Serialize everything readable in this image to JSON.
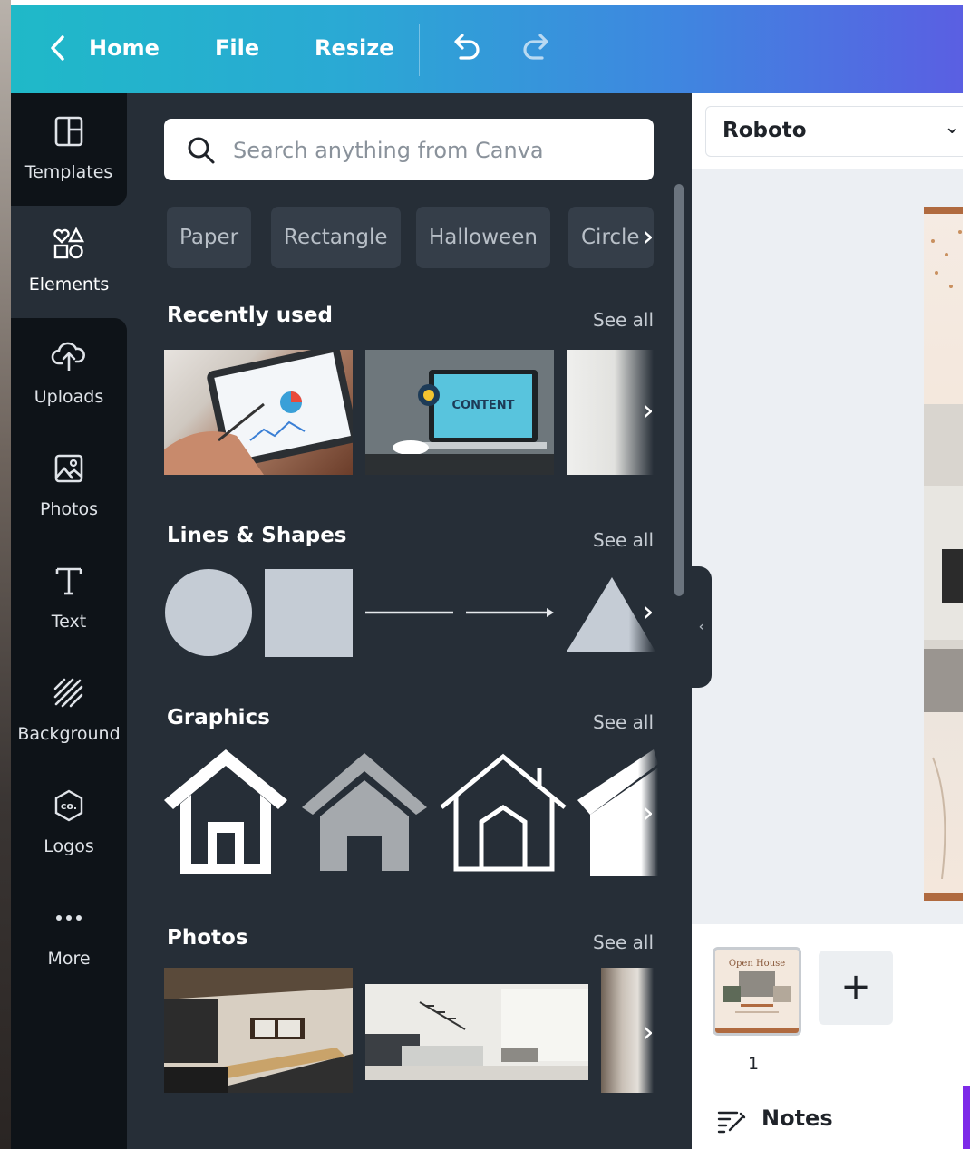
{
  "topbar": {
    "home_label": "Home",
    "file_label": "File",
    "resize_label": "Resize"
  },
  "sidebar": {
    "items": [
      {
        "label": "Templates",
        "icon": "templates-icon"
      },
      {
        "label": "Elements",
        "icon": "elements-icon"
      },
      {
        "label": "Uploads",
        "icon": "upload-cloud-icon"
      },
      {
        "label": "Photos",
        "icon": "photo-icon"
      },
      {
        "label": "Text",
        "icon": "text-icon"
      },
      {
        "label": "Background",
        "icon": "background-hatch-icon"
      },
      {
        "label": "Logos",
        "icon": "logo-co-icon"
      },
      {
        "label": "More",
        "icon": "more-dots-icon"
      }
    ]
  },
  "panel": {
    "search": {
      "placeholder": "Search anything from Canva"
    },
    "chips": [
      "Paper",
      "Rectangle",
      "Halloween",
      "Circle"
    ],
    "sections": {
      "recent": {
        "title": "Recently used",
        "see_all": "See all"
      },
      "shapes": {
        "title": "Lines & Shapes",
        "see_all": "See all"
      },
      "graphics": {
        "title": "Graphics",
        "see_all": "See all"
      },
      "photos": {
        "title": "Photos",
        "see_all": "See all"
      }
    },
    "recent_thumb_text": "CONTENT"
  },
  "editor": {
    "font_name": "Roboto",
    "page_number": "1",
    "page_thumb_title": "Open House",
    "notes_label": "Notes"
  },
  "colors": {
    "topbar_start": "#1fb9c8",
    "topbar_end": "#5a5fe2",
    "sidebar_bg": "#0e1318",
    "panel_bg": "#262e37",
    "accent_purple": "#7d2ae8"
  }
}
